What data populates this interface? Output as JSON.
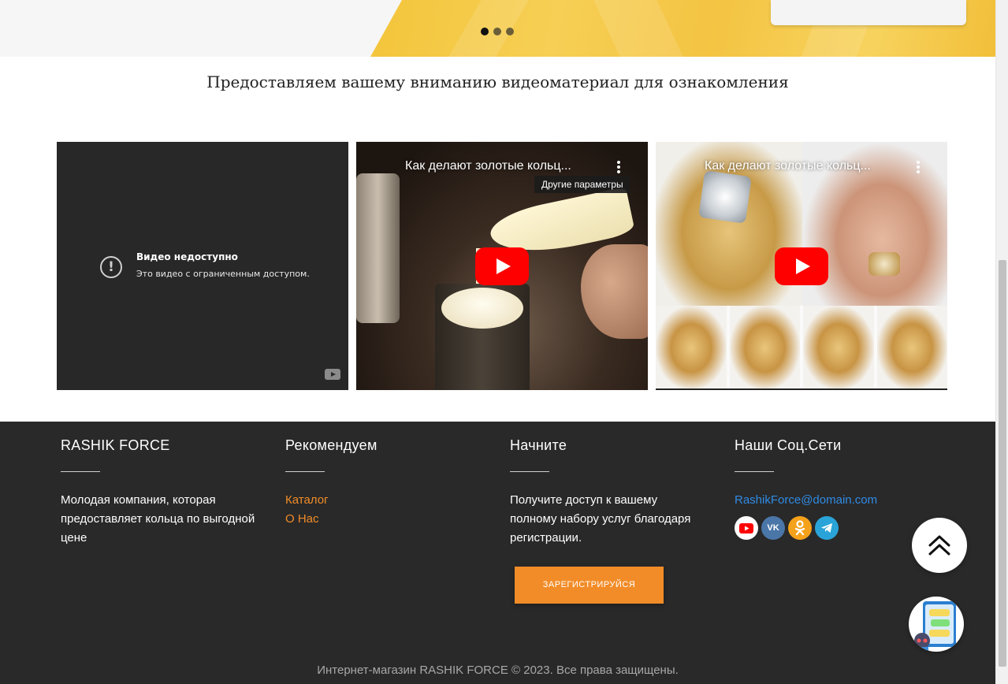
{
  "hero": {
    "slides": [
      {
        "label": "slide-1",
        "active": true
      },
      {
        "label": "slide-2",
        "active": false
      },
      {
        "label": "slide-3",
        "active": false
      }
    ]
  },
  "section": {
    "title": "Предоставляем вашему вниманию видеоматериал для ознакомления"
  },
  "videos": [
    {
      "state": "unavailable",
      "error_icon": "exclamation-circle-icon",
      "error_title": "Видео недоступно",
      "error_subtitle": "Это видео с ограниченным доступом.",
      "brand_icon": "youtube-icon"
    },
    {
      "state": "playable",
      "title": "Как делают золотые кольц...",
      "menu_icon": "more-vertical-icon",
      "tooltip": "Другие параметры",
      "play_icon": "youtube-play-icon"
    },
    {
      "state": "playable",
      "title": "Как делают золотые кольц...",
      "menu_icon": "more-vertical-icon",
      "play_icon": "youtube-play-icon"
    }
  ],
  "footer": {
    "about": {
      "heading": "RASHIK FORCE",
      "text": "Молодая компания, которая предоставляет кольца по выгодной цене"
    },
    "recommend": {
      "heading": "Рекомендуем",
      "links": [
        "Каталог",
        "О Нас"
      ]
    },
    "start": {
      "heading": "Начните",
      "text": "Получите доступ к вашему полному набору услуг благодаря регистрации.",
      "cta": "ЗАРЕГИСТРИРУЙСЯ"
    },
    "social": {
      "heading": "Наши Соц.Сети",
      "email": "RashikForce@domain.com",
      "icons": [
        "youtube-icon",
        "vk-icon",
        "odnoklassniki-icon",
        "telegram-icon"
      ],
      "vk_label": "VK"
    },
    "copyright": "Интернет-магазин RASHIK FORCE © 2023. Все права защищены."
  },
  "floating": {
    "to_top_icon": "double-chevron-up-icon",
    "chat_icon": "chat-bot-icon"
  },
  "colors": {
    "accent": "#f28c28",
    "link": "#2f8be6",
    "footer_bg": "#292929",
    "youtube_red": "#ff0000"
  }
}
